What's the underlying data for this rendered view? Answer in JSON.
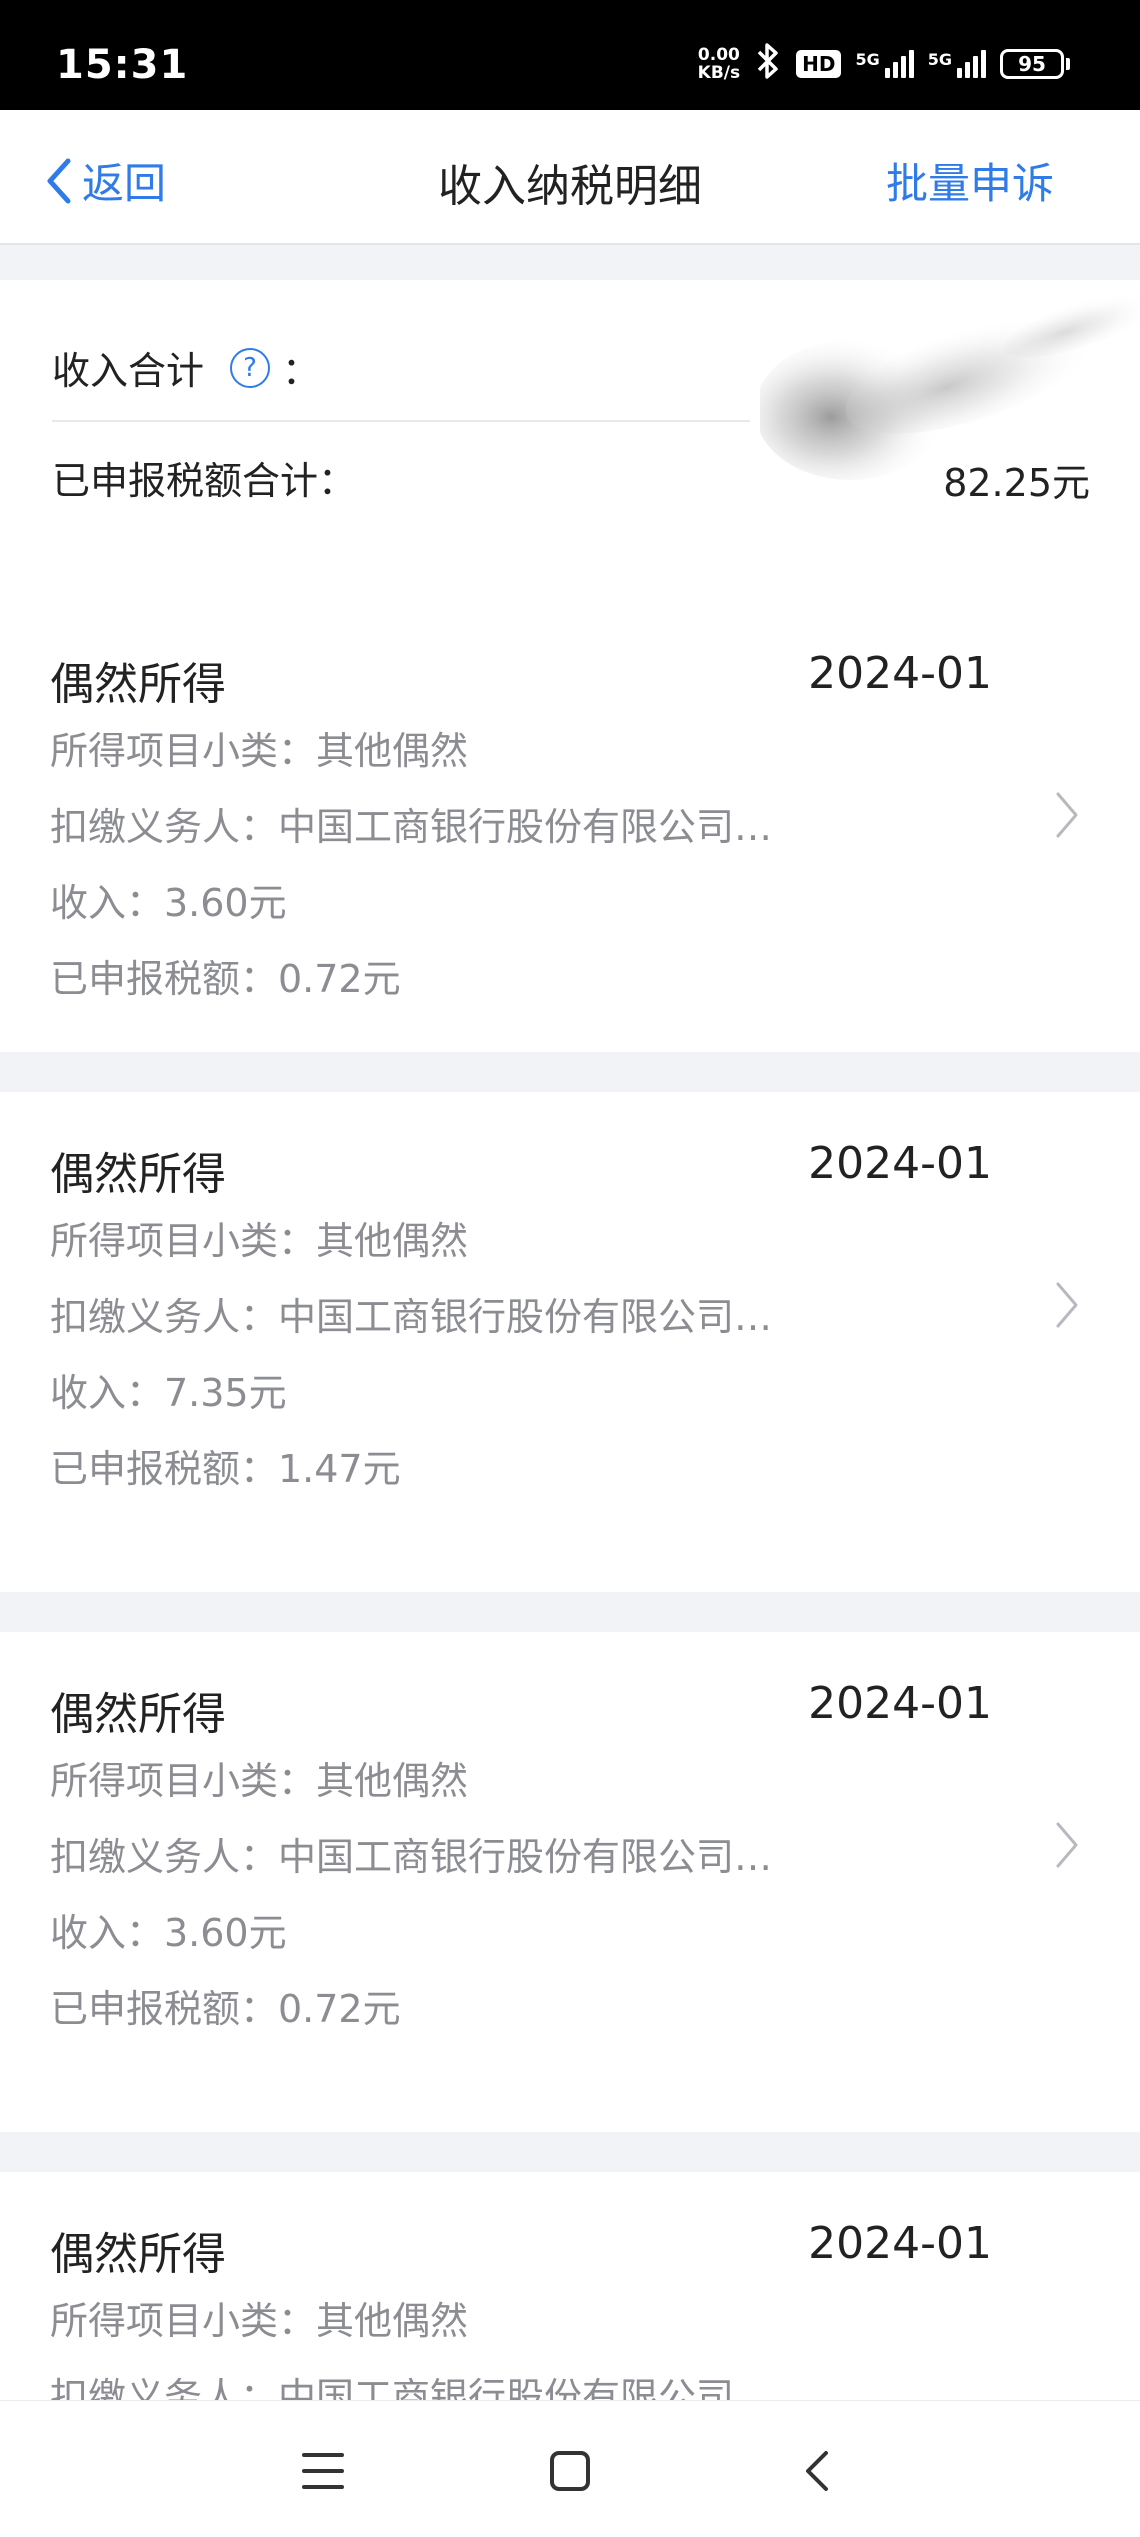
{
  "status_bar": {
    "time": "15:31",
    "net_speed_value": "0.00",
    "net_speed_unit": "KB/s",
    "hd_label": "HD",
    "signal1_label": "5G",
    "signal2_label": "5G",
    "battery_level": "95"
  },
  "nav": {
    "back_label": "返回",
    "title": "收入纳税明细",
    "action_label": "批量申诉"
  },
  "summary": {
    "income_total_label": "收入合计",
    "help_glyph": "?",
    "income_colon": "：",
    "tax_total_label": "已申报税额合计：",
    "tax_total_value": "82.25元"
  },
  "records": [
    {
      "title": "偶然所得",
      "date": "2024-01",
      "subcategory": "所得项目小类：其他偶然",
      "withholder": "扣缴义务人：中国工商银行股份有限公司…",
      "income": "收入：3.60元",
      "tax": "已申报税额：0.72元"
    },
    {
      "title": "偶然所得",
      "date": "2024-01",
      "subcategory": "所得项目小类：其他偶然",
      "withholder": "扣缴义务人：中国工商银行股份有限公司…",
      "income": "收入：7.35元",
      "tax": "已申报税额：1.47元"
    },
    {
      "title": "偶然所得",
      "date": "2024-01",
      "subcategory": "所得项目小类：其他偶然",
      "withholder": "扣缴义务人：中国工商银行股份有限公司…",
      "income": "收入：3.60元",
      "tax": "已申报税额：0.72元"
    },
    {
      "title": "偶然所得",
      "date": "2024-01",
      "subcategory": "所得项目小类：其他偶然",
      "withholder": "扣缴义务人：中国工商银行股份有限公司…"
    }
  ],
  "icons": {
    "back": "chevron-left-icon",
    "help": "question-circle-icon",
    "row_arrow": "chevron-right-icon",
    "menu": "menu-icon",
    "home": "home-square-icon",
    "back_system": "back-arrow-icon"
  },
  "colors": {
    "accent": "#2f7be8",
    "secondary_text": "#8c8d92",
    "page_background": "#f2f3f7"
  }
}
